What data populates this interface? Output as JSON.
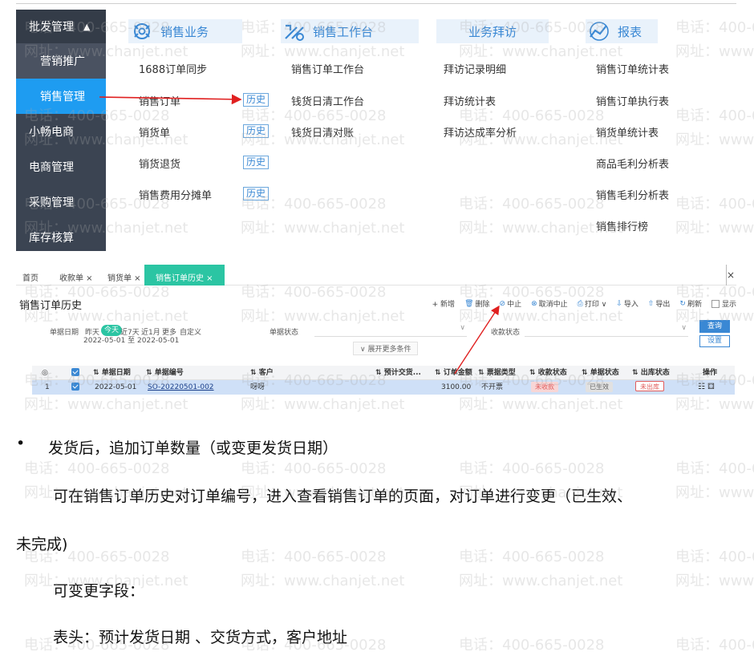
{
  "watermark": {
    "phone": "电话：400-665-0028",
    "site": "网址：www.chanjet.net"
  },
  "sidebar": {
    "header": "批发管理",
    "items": [
      {
        "label": "营销推广",
        "state": "sub"
      },
      {
        "label": "销售管理",
        "state": "active"
      },
      {
        "label": "小畅电商",
        "state": "normal"
      },
      {
        "label": "电商管理",
        "state": "normal"
      },
      {
        "label": "采购管理",
        "state": "normal"
      },
      {
        "label": "库存核算",
        "state": "normal"
      }
    ]
  },
  "menu": {
    "col1": {
      "title": "销售业务",
      "items": [
        "1688订单同步",
        "销售订单",
        "销货单",
        "销货退货",
        "销售费用分摊单"
      ],
      "history": "历史"
    },
    "col2": {
      "title": "销售工作台",
      "items": [
        "销售订单工作台",
        "钱货日清工作台",
        "钱货日清对账"
      ]
    },
    "col3": {
      "title": "业务拜访",
      "items": [
        "拜访记录明细",
        "拜访统计表",
        "拜访达成率分析"
      ]
    },
    "col4": {
      "title": "报表",
      "items": [
        "销售订单统计表",
        "销售订单执行表",
        "销货单统计表",
        "商品毛利分析表",
        "销售毛利分析表",
        "销售排行榜"
      ]
    }
  },
  "app": {
    "tabs": [
      "首页",
      "收款单 ×",
      "销货单 ×",
      "销售订单历史 ×"
    ],
    "close": "×",
    "title": "销售订单历史",
    "toolbar": [
      "+ 新增",
      "删除",
      "中止",
      "取消中止",
      "打印 ∨",
      "导入",
      "导出",
      "刷新",
      "显示"
    ],
    "filters": {
      "date_label": "单据日期",
      "quick": [
        "昨天",
        "今天",
        "近7天",
        "近1月",
        "更多",
        "自定义"
      ],
      "range": "2022-05-01 至 2022-05-01",
      "status_label": "单据状态",
      "receipt_label": "收款状态",
      "expand": "∨ 展开更多条件",
      "query": "查询",
      "settings": "设置"
    },
    "table": {
      "headers": [
        "◎",
        "",
        "单据日期",
        "单据编号",
        "客户",
        "预计交货...",
        "订单金额",
        "票据类型",
        "收款状态",
        "单据状态",
        "出库状态",
        "操作"
      ],
      "rows": [
        {
          "idx": "1",
          "date": "2022-05-01",
          "no": "SO-20220501-002",
          "customer": "呀呀",
          "eta": "",
          "amount": "3100.00",
          "ticket": "不开票",
          "pay": "未收款",
          "status": "已生效",
          "out": "未出库",
          "ops": "☷ ⚃"
        }
      ]
    }
  },
  "doc": {
    "bullet": "•",
    "line1": "发货后，追加订单数量（或变更发货日期）",
    "line2": "可在销售订单历史对订单编号，进入查看销售订单的页面，对订单进行变更（已生效、",
    "line3": "未完成)",
    "line4": "可变更字段：",
    "line5": "表头：预计发货日期 、交货方式，客户地址"
  }
}
